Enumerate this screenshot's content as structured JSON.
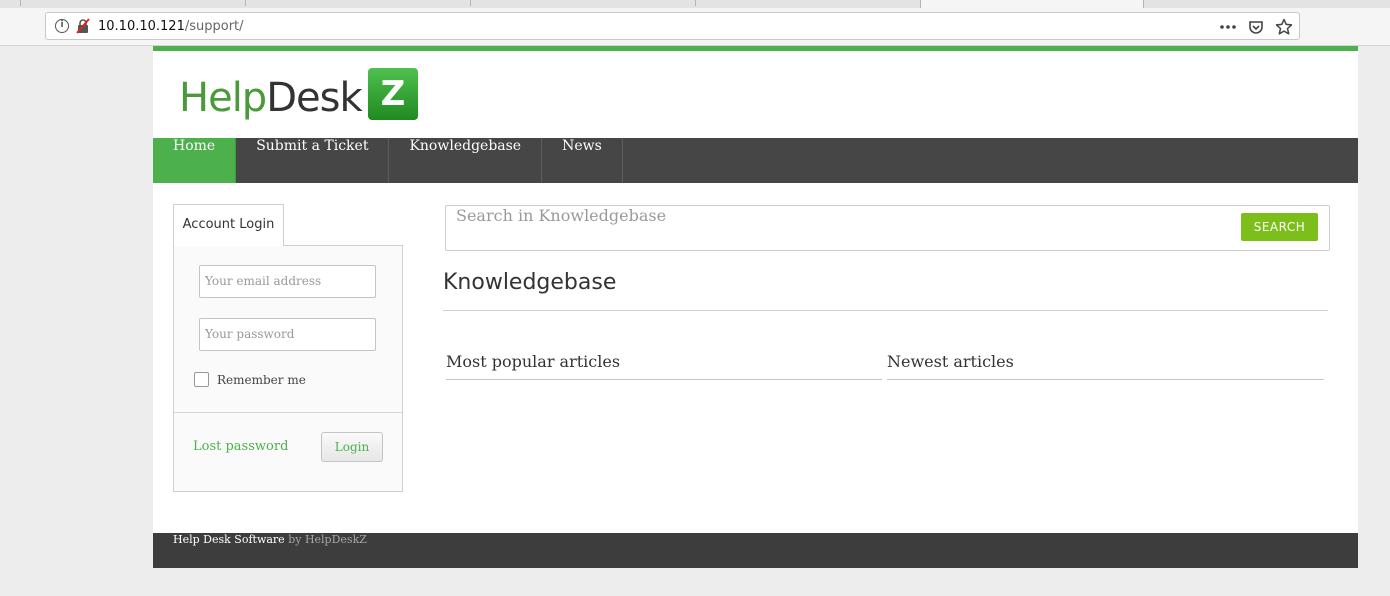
{
  "browser": {
    "url_host": "10.10.10.121",
    "url_path": "/support/",
    "icons": [
      "info-icon",
      "insecure-connection-icon",
      "more-actions-icon",
      "pocket-icon",
      "bookmark-star-icon"
    ]
  },
  "site": {
    "logo": {
      "part1": "Help",
      "part2": "Desk",
      "box_letter": "Z"
    },
    "nav": {
      "home": "Home",
      "submit_ticket": "Submit a Ticket",
      "knowledgebase": "Knowledgebase",
      "news": "News"
    },
    "login": {
      "tab_label": "Account Login",
      "email_placeholder": "Your email address",
      "password_placeholder": "Your password",
      "remember_label": "Remember me",
      "lost_password": "Lost password",
      "login_button": "Login"
    },
    "search": {
      "placeholder": "Search in Knowledgebase",
      "button": "SEARCH"
    },
    "content": {
      "title": "Knowledgebase",
      "popular": "Most popular articles",
      "newest": "Newest articles"
    },
    "footer": {
      "strong": "Help Desk Software",
      "muted": "by HelpDeskZ"
    },
    "colors": {
      "brand_green": "#4cb04c",
      "search_green": "#7cbf1a",
      "nav_dark": "#464646",
      "footer_dark": "#3d3d3d"
    }
  }
}
